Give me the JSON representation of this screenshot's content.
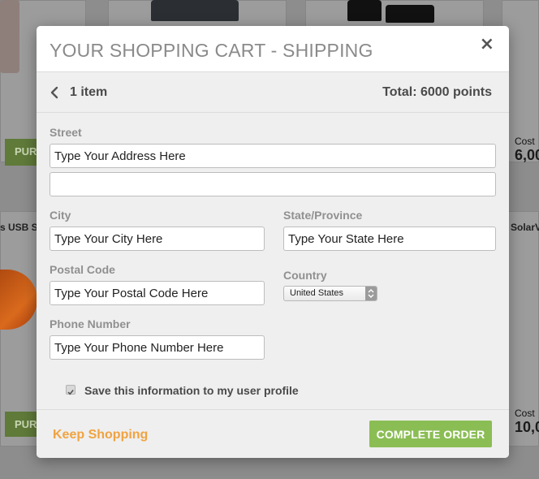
{
  "background": {
    "purchase_label_top": "PURC",
    "purchase_label_bottom": "PURC",
    "product_left_name": "s USB S",
    "product_right_name": "SolarV",
    "cost_label_top": "Cost",
    "cost_value_top": "6,00",
    "cost_label_bottom": "Cost",
    "cost_value_bottom": "10,0"
  },
  "modal": {
    "title": "YOUR SHOPPING CART - SHIPPING",
    "close_label": "×",
    "summary": {
      "item_count": "1 item",
      "total": "Total: 6000 points"
    },
    "form": {
      "street_label": "Street",
      "street_line1_value": "Type Your Address Here",
      "street_line2_value": "",
      "city_label": "City",
      "city_value": "Type Your City Here",
      "state_label": "State/Province",
      "state_value": "Type Your State Here",
      "postal_label": "Postal Code",
      "postal_value": "Type Your Postal Code Here",
      "country_label": "Country",
      "country_selected": "United States",
      "phone_label": "Phone Number",
      "phone_value": "Type Your Phone Number Here",
      "save_profile_label": "Save this information to my user profile",
      "save_profile_checked": true
    },
    "footer": {
      "keep_shopping": "Keep Shopping",
      "complete_order": "COMPLETE ORDER"
    }
  },
  "colors": {
    "accent_green": "#8bbd55",
    "link_orange": "#f0a341",
    "title_gray": "#8a8a8a"
  },
  "icons": [
    "chevron-left-icon",
    "close-icon",
    "select-arrows-icon",
    "check-icon"
  ]
}
